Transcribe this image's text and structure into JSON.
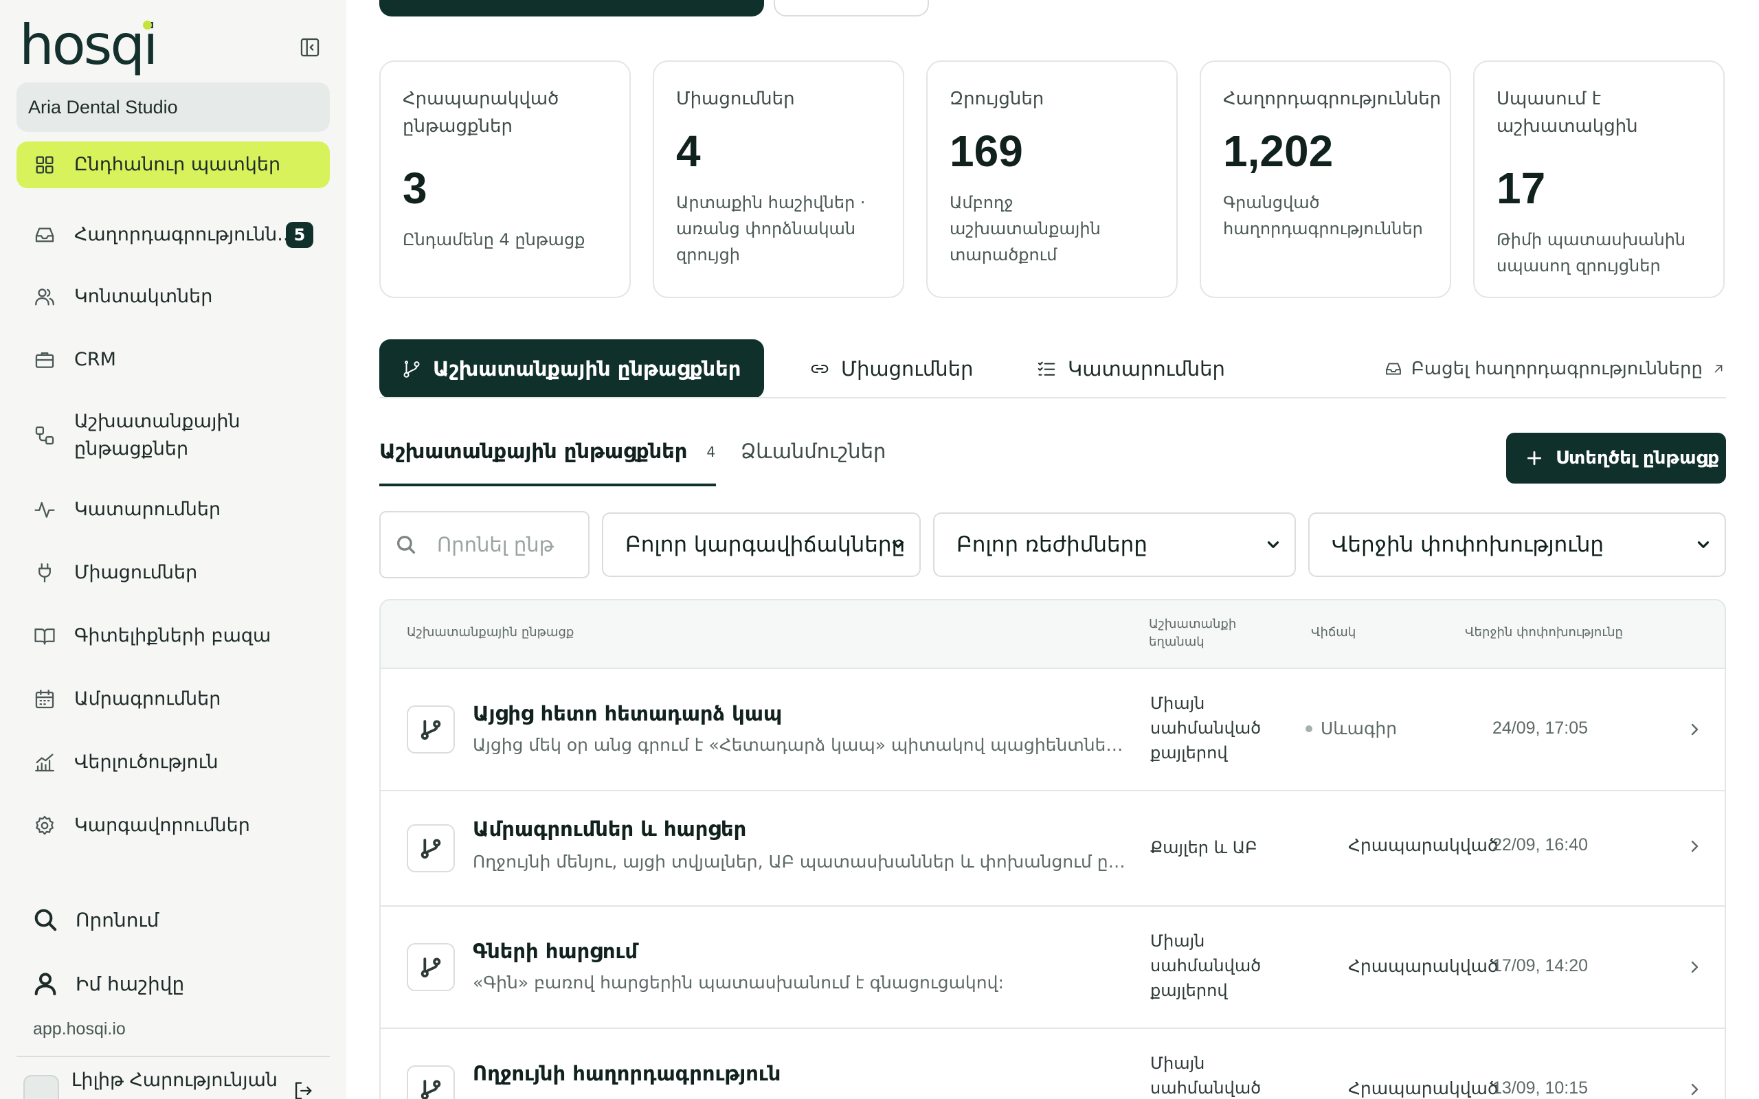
{
  "brand": {
    "logo_text": "hosqi",
    "accent": "#d7f25a",
    "dark": "#10302c"
  },
  "sidebar": {
    "workspace": "Aria Dental Studio",
    "items": [
      {
        "label": "Ընդհանուր պատկեր",
        "icon": "grid-icon",
        "active": true
      },
      {
        "label": "Հաղորդագրությունն...",
        "icon": "inbox-icon",
        "badge": "5"
      },
      {
        "label": "Կոնտակտներ",
        "icon": "users-icon"
      },
      {
        "label": "CRM",
        "icon": "briefcase-icon"
      },
      {
        "label": "Աշխատանքային ընթացքներ",
        "icon": "workflow-icon"
      },
      {
        "label": "Կատարումներ",
        "icon": "activity-icon"
      },
      {
        "label": "Միացումներ",
        "icon": "plug-icon"
      },
      {
        "label": "Գիտելիքների բազա",
        "icon": "book-icon"
      },
      {
        "label": "Ամրագրումներ",
        "icon": "calendar-icon"
      },
      {
        "label": "Վերլուծություն",
        "icon": "chart-icon"
      },
      {
        "label": "Կարգավորումներ",
        "icon": "gear-icon"
      }
    ],
    "search_label": "Որոնում",
    "account_label": "Իմ հաշիվը",
    "app_url": "app.hosqi.io",
    "user_name": "Լիլիթ Հարությունյան"
  },
  "stats": [
    {
      "title": "Հրապարակված ընթացքներ",
      "value": "3",
      "sub": "Ընդամենը 4 ընթացք"
    },
    {
      "title": "Միացումներ",
      "value": "4",
      "sub": "Արտաքին հաշիվներ · առանց փորձնական զրույցի"
    },
    {
      "title": "Զրույցներ",
      "value": "169",
      "sub": "Ամբողջ աշխատանքային տարածքում"
    },
    {
      "title": "Հաղորդագրություններ",
      "value": "1,202",
      "sub": "Գրանցված հաղորդագրություններ"
    },
    {
      "title": "Սպասում է աշխատակցին",
      "value": "17",
      "sub": "Թիմի պատասխանին սպասող զրույցներ"
    }
  ],
  "tabs": {
    "workflows": "Աշխատանքային ընթացքներ",
    "integrations": "Միացումներ",
    "runs": "Կատարումներ",
    "open_conversations": "Բացել հաղորդագրությունները"
  },
  "subtabs": {
    "workflows": "Աշխատանքային ընթացքներ",
    "workflows_count": "4",
    "templates": "Ձևանմուշներ"
  },
  "create_button": "Ստեղծել ընթացք",
  "filters": {
    "search_placeholder": "Որոնել ընթ",
    "status": "Բոլոր կարգավիճակները",
    "mode": "Բոլոր ռեժիմները",
    "sort": "Վերջին փոփոխությունը"
  },
  "table": {
    "columns": [
      "Աշխատանքային ընթացք",
      "Աշխատանքի եղանակ",
      "Վիճակ",
      "Վերջին փոփոխությունը"
    ],
    "rows": [
      {
        "title": "Այցից հետո հետադարձ կապ",
        "desc": "Այցից մեկ օր անց գրում է «Հետադարձ կապ» պիտակով պացիենտներին:",
        "mode": "Միայն սահմանված քայլերով",
        "status": "Սևագիր",
        "date": "24/09, 17:05",
        "draft": true
      },
      {
        "title": "Ամրագրումներ և հարցեր",
        "desc": "Ողջույնի մենյու, այցի տվյալներ, ԱԲ պատասխաններ և փոխանցում ընդունարանին",
        "mode": "Քայլեր և ԱԲ",
        "status": "Հրապարակված",
        "date": "22/09, 16:40",
        "draft": false
      },
      {
        "title": "Գների հարցում",
        "desc": "«Գին» բառով հարցերին պատասխանում է գնացուցակով:",
        "mode": "Միայն սահմանված քայլերով",
        "status": "Հրապարակված",
        "date": "17/09, 14:20",
        "draft": false
      },
      {
        "title": "Ողջույնի հաղորդագրություն",
        "desc": "",
        "mode": "Միայն սահմանված քայլերով",
        "status": "Հրապարակված",
        "date": "13/09, 10:15",
        "draft": false
      }
    ]
  }
}
